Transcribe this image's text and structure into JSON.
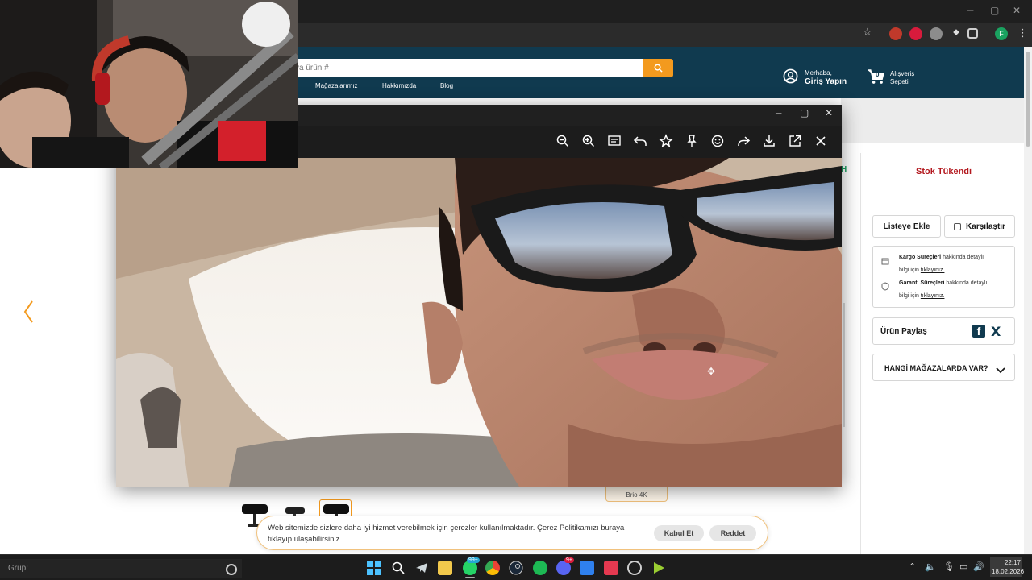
{
  "browser": {
    "window_controls": {
      "minimize": "─",
      "maximize": "▢",
      "close": "✕"
    },
    "profile_initial": "F"
  },
  "site": {
    "search": {
      "placeholder": "ya ürün #"
    },
    "nav": [
      "Mağazalarımız",
      "Hakkımızda",
      "Blog"
    ],
    "account": {
      "greeting": "Merhaba,",
      "login": "Giriş Yapın"
    },
    "cart": {
      "count": "0",
      "label1": "Alışveriş",
      "label2": "Sepeti"
    },
    "accent_color": "#f39a1e",
    "header_color": "#103a4f"
  },
  "product": {
    "stock_status": "Stok Tükendi",
    "add_to_list": "Listeye Ekle",
    "compare": "Karşılaştır",
    "info": [
      {
        "bold": "Kargo Süreçleri",
        "text": " hakkında detaylı",
        "text2": "bilgi için ",
        "link": "tıklayınız."
      },
      {
        "bold": "Garanti Süreçleri",
        "text": " hakkında detaylı",
        "text2": "bilgi için ",
        "link": "tıklayınız."
      }
    ],
    "share_label": "Ürün Paylaş",
    "stores_label": "HANGİ MAĞAZALARDA VAR?",
    "variant_label": "Brio 4K"
  },
  "viewer": {
    "controls": {
      "minimize": "─",
      "maximize": "▢",
      "close": "✕"
    },
    "tools": [
      "zoom-out-icon",
      "zoom-in-icon",
      "slideshow-icon",
      "undo-icon",
      "star-icon",
      "pin-icon",
      "emoji-icon",
      "share-icon",
      "download-icon",
      "open-external-icon",
      "close-icon"
    ]
  },
  "cookie": {
    "text": "Web sitemizde sizlere daha iyi hizmet verebilmek için çerezler kullanılmaktadır. Çerez Politikamızı buraya tıklayıp ulaşabilirsiniz.",
    "accept": "Kabul Et",
    "reject": "Reddet"
  },
  "taskbar": {
    "search_text": "Grup:",
    "badge_whatsapp": "99+",
    "badge_discord": "9+",
    "time": "22:17",
    "date": "18.02.2026"
  }
}
